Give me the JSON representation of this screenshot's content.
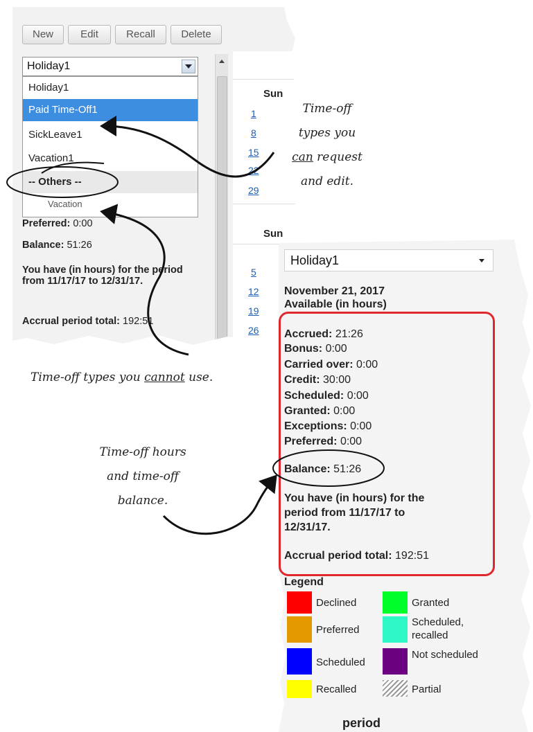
{
  "toolbar": {
    "new": "New",
    "edit": "Edit",
    "recall": "Recall",
    "delete": "Delete"
  },
  "type_dropdown": {
    "selected": "Holiday1",
    "options": [
      "Holiday1",
      "Paid Time-Off1",
      "SickLeave1",
      "Vacation1"
    ],
    "highlighted": "Paid Time-Off1",
    "group_label": "-- Others --",
    "other_options": [
      "Vacation"
    ]
  },
  "calendar": {
    "weekday_header": "Sun",
    "month1_days": [
      "1",
      "8",
      "15",
      "22",
      "29"
    ],
    "month2_days": [
      "5",
      "12",
      "19",
      "26"
    ]
  },
  "panel1_info": {
    "preferred_label": "Preferred:",
    "preferred_value": "0:00",
    "balance_label": "Balance:",
    "balance_value": "51:26",
    "period_text": "You have (in hours) for the period from 11/17/17 to 12/31/17.",
    "accrual_label": "Accrual period total:",
    "accrual_value": "192:51"
  },
  "panel2": {
    "dropdown_value": "Holiday1",
    "date": "November 21, 2017",
    "available_heading": "Available (in hours)",
    "rows": [
      {
        "label": "Accrued:",
        "value": "21:26"
      },
      {
        "label": "Bonus:",
        "value": "0:00"
      },
      {
        "label": "Carried over:",
        "value": "0:00"
      },
      {
        "label": "Credit:",
        "value": "30:00"
      },
      {
        "label": "Scheduled:",
        "value": "0:00"
      },
      {
        "label": "Granted:",
        "value": "0:00"
      },
      {
        "label": "Exceptions:",
        "value": "0:00"
      },
      {
        "label": "Preferred:",
        "value": "0:00"
      }
    ],
    "balance_label": "Balance:",
    "balance_value": "51:26",
    "period_text_1": "You have (in hours) for the",
    "period_text_2": "period from 11/17/17 to",
    "period_text_3": "12/31/17.",
    "accrual_label": "Accrual period total:",
    "accrual_value": "192:51",
    "legend_title": "Legend",
    "legend": [
      {
        "label": "Declined",
        "color": "#ff0000"
      },
      {
        "label": "Granted",
        "color": "#00ff2a"
      },
      {
        "label": "Preferred",
        "color": "#e39a00"
      },
      {
        "label": "Scheduled, recalled",
        "color": "#2ef7c8"
      },
      {
        "label": "Scheduled",
        "color": "#0000ff"
      },
      {
        "label": "Not scheduled",
        "color": "#6b0080"
      },
      {
        "label": "Recalled",
        "color": "#ffff00"
      },
      {
        "label": "Partial",
        "color": "hatched"
      }
    ],
    "footer_partial": "period"
  },
  "annotations": {
    "can_edit_1": "Time-off",
    "can_edit_2": "types you",
    "can_edit_3a": "can",
    "can_edit_3b": " request",
    "can_edit_4": "and edit.",
    "cannot_1": "Time-off types you ",
    "cannot_2": "cannot",
    "cannot_3": " use.",
    "hours_1": "Time-off hours",
    "hours_2": "and time-off",
    "hours_3": "balance."
  }
}
